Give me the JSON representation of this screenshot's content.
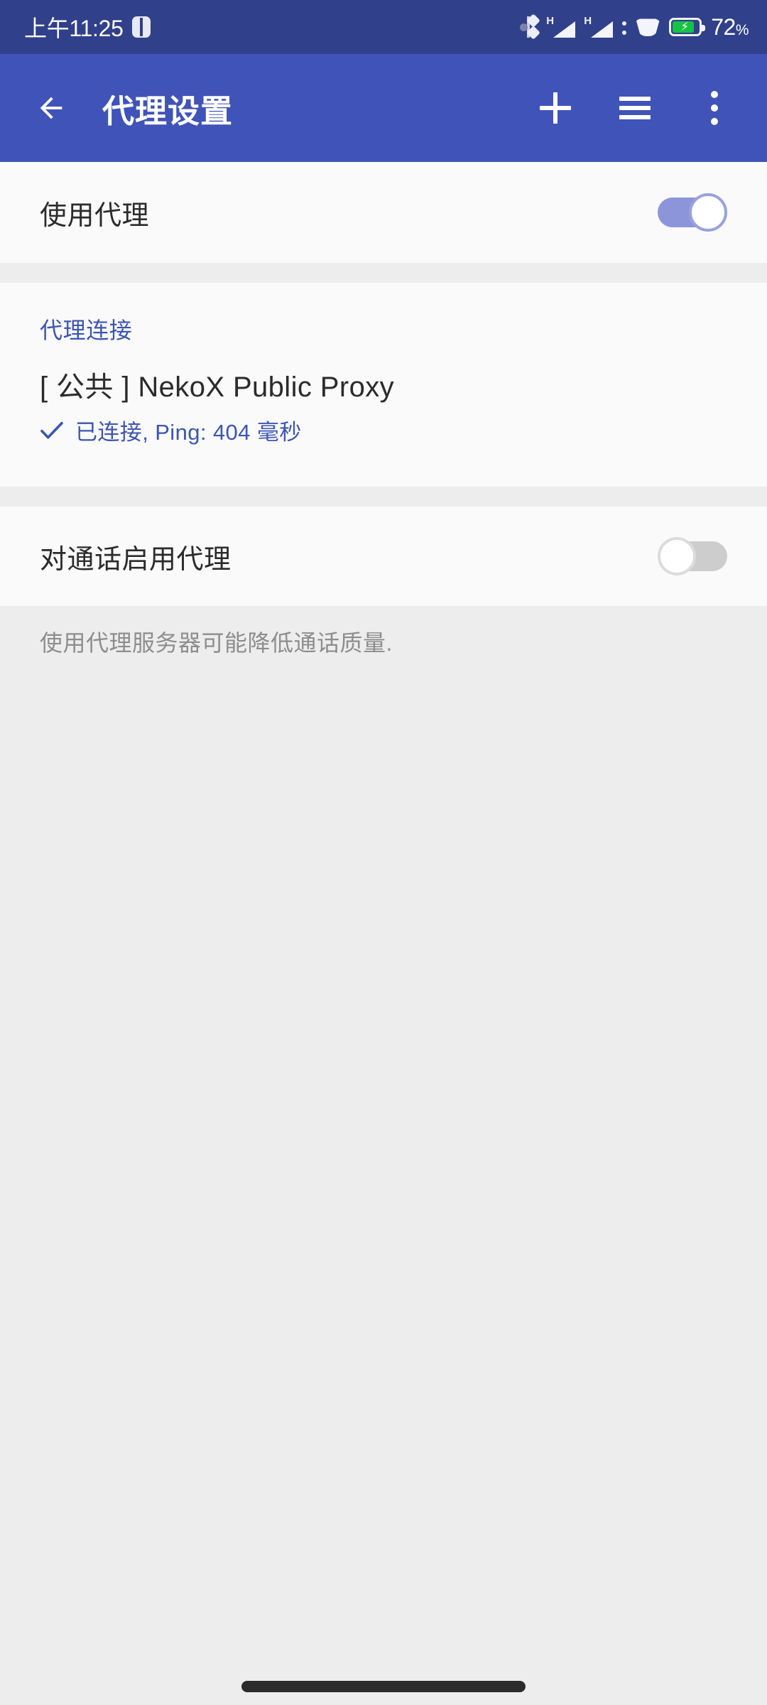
{
  "status_bar": {
    "clock": "上午11:25",
    "battery_percent": "72",
    "battery_unit": "%",
    "network_label_sim1": "H",
    "network_label_sim2": "H",
    "icons": [
      "alarm-icon",
      "bluetooth-icon",
      "signal-icon-sim1",
      "signal-icon-sim2",
      "wifi-icon",
      "battery-charging-icon"
    ],
    "background_color": "#30408a",
    "accent_battery_color": "#16c244"
  },
  "app_bar": {
    "title": "代理设置",
    "back_icon": "arrow-left-icon",
    "actions": [
      {
        "name": "add-proxy-button",
        "icon": "plus-icon"
      },
      {
        "name": "proxy-list-button",
        "icon": "hamburger-menu-icon"
      },
      {
        "name": "overflow-menu-button",
        "icon": "kebab-menu-icon"
      }
    ],
    "background_color": "#4053b8"
  },
  "rows": {
    "use_proxy": {
      "label": "使用代理",
      "toggle_state": "on",
      "toggle_on_color": "#8d95da"
    },
    "calls_proxy": {
      "label": "对通话启用代理",
      "toggle_state": "off",
      "toggle_off_color": "#cdcdcd"
    }
  },
  "connection": {
    "section_header": "代理连接",
    "proxy_name": "[ 公共 ] NekoX Public Proxy",
    "status_text": "已连接, Ping: 404 毫秒",
    "status_icon": "check-icon",
    "accent_color": "#3c55b3",
    "ping_ms": "404"
  },
  "footer": {
    "hint": "使用代理服务器可能降低通话质量."
  },
  "system_nav": {
    "gesture_pill": "home-gesture-pill"
  }
}
